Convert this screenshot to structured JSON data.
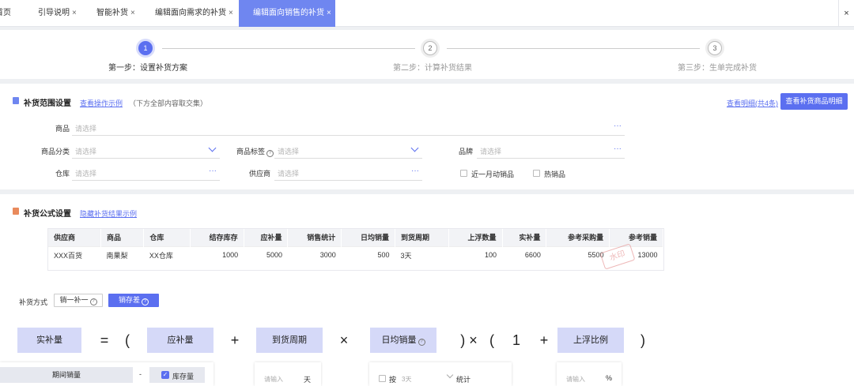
{
  "tabs": [
    {
      "label": "首页",
      "closable": false
    },
    {
      "label": "引导说明",
      "closable": true
    },
    {
      "label": "智能补货",
      "closable": true
    },
    {
      "label": "编辑面向需求的补货",
      "closable": true
    },
    {
      "label": "编辑面向销售的补货",
      "closable": true,
      "active": true
    }
  ],
  "close_symbol": "×",
  "close_all_symbol": "×",
  "steps": [
    {
      "num": "1",
      "label": "第一步：设置补货方案",
      "active": true
    },
    {
      "num": "2",
      "label": "第二步：计算补货结果",
      "active": false
    },
    {
      "num": "3",
      "label": "第三步：生单完成补货",
      "active": false
    }
  ],
  "scope": {
    "title": "补货范围设置",
    "guide_link": "查看操作示例",
    "hint": "（下方全部内容取交集）",
    "detail_link": "查看明细(共4条)",
    "view_button": "查看补货商品明细",
    "placeholder": "请选择",
    "fields": {
      "product": "商品",
      "category": "商品分类",
      "tag": "商品标签",
      "brand": "品牌",
      "warehouse": "仓库",
      "supplier": "供应商"
    },
    "more_symbol": "···",
    "checkboxes": [
      "近一月动销品",
      "热销品"
    ]
  },
  "formula_section": {
    "title": "补货公式设置",
    "hide_link": "隐藏补货结果示例",
    "table": {
      "headers": [
        "供应商",
        "商品",
        "仓库",
        "结存库存",
        "应补量",
        "销售统计",
        "日均销量",
        "到货周期",
        "上浮数量",
        "实补量",
        "参考采购量",
        "参考销量"
      ],
      "rows": [
        [
          "XXX百货",
          "南果梨",
          "XX仓库",
          "1000",
          "5000",
          "3000",
          "500",
          "3天",
          "100",
          "6600",
          "5500",
          "13000"
        ]
      ]
    },
    "stamp_text": "水印",
    "method_label": "补货方式",
    "methods": [
      {
        "label": "销一补一",
        "active": false
      },
      {
        "label": "销存差",
        "active": true
      }
    ],
    "formula": {
      "actual": "实补量",
      "equals": "=",
      "lparen": "(",
      "should": "应补量",
      "plus": "+",
      "cycle": "到货周期",
      "times": "×",
      "daily": "日均销量",
      "rparen_times": ")  ×",
      "lparen2": "(",
      "one": "1",
      "plus2": "+",
      "float_ratio": "上浮比例",
      "rparen2": ")"
    },
    "sub": {
      "period_sales": "期间销量",
      "minus": "-",
      "stock": "库存量",
      "input_ph": "请输入",
      "unit_day": "天",
      "by": "按",
      "days": "3天",
      "stat": "统计",
      "unit_pct": "%"
    }
  },
  "colors": {
    "accent": "#5b6ff0",
    "tab_active": "#6f86f0",
    "formula_box": "#d5d9f8"
  }
}
